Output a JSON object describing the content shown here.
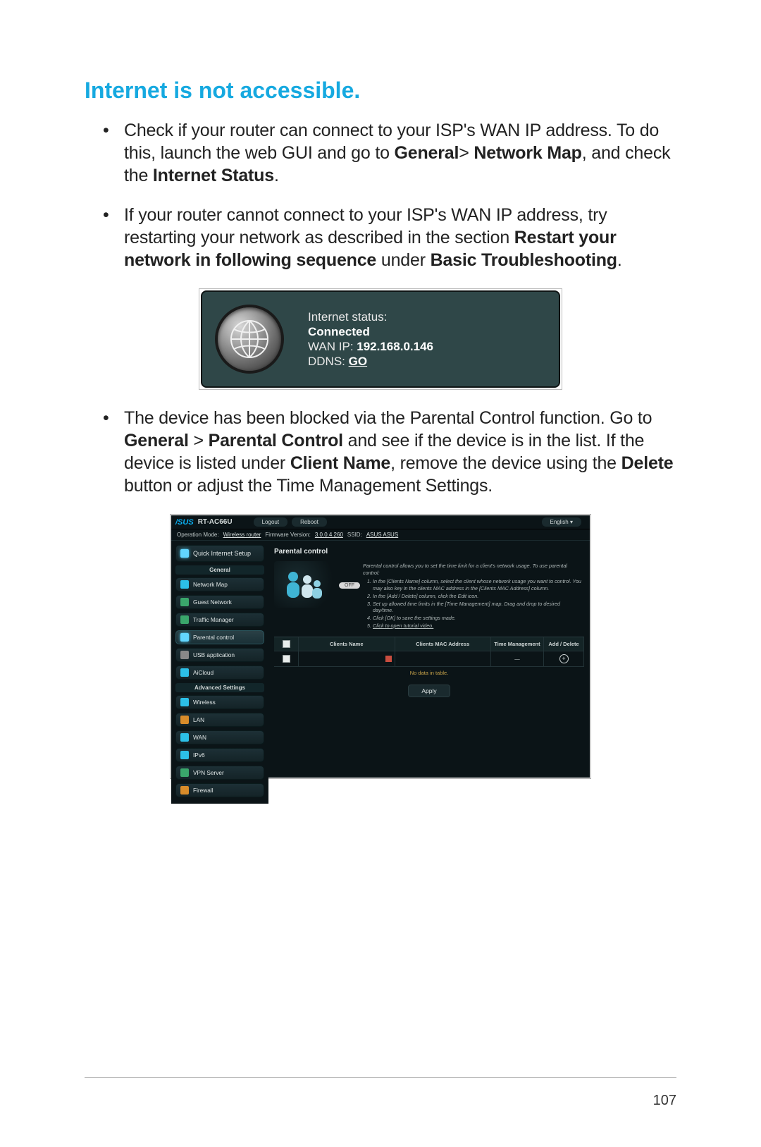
{
  "title": "Internet is not accessible.",
  "bullets": {
    "b1_pre": "Check if your router can connect to your ISP's WAN IP address. To do this, launch the web GUI and go to ",
    "b1_bold1": "General",
    "b1_mid1": "> ",
    "b1_bold2": "Network Map",
    "b1_mid2": ", and check the ",
    "b1_bold3": "Internet Status",
    "b1_end": ".",
    "b2_pre": "If your router cannot connect to your ISP's WAN IP address, try restarting your network as described in the section ",
    "b2_bold1": "Restart your network in following sequence",
    "b2_mid1": " under ",
    "b2_bold2": "Basic Troubleshooting",
    "b2_end": ".",
    "b3_pre": "The device has been blocked via the Parental Control function. Go to ",
    "b3_bold1": "General",
    "b3_mid1": " > ",
    "b3_bold2": "Parental Control",
    "b3_mid2": " and see if the device is in the list. If the device is listed under ",
    "b3_bold3": "Client Name",
    "b3_mid3": ", remove the device using the ",
    "b3_bold4": "Delete",
    "b3_end": " button or adjust the Time Management Settings."
  },
  "status_card": {
    "line1": "Internet status:",
    "line2": "Connected",
    "wan_label": "WAN IP: ",
    "wan_value": "192.168.0.146",
    "ddns_label": "DDNS: ",
    "ddns_value": "GO"
  },
  "gui": {
    "brand": "/SUS",
    "model": "RT-AC66U",
    "btn_logout": "Logout",
    "btn_reboot": "Reboot",
    "lang": "English",
    "op_mode_label": "Operation Mode:",
    "op_mode_value": "Wireless router",
    "fw_label": "Firmware Version:",
    "fw_value": "3.0.0.4.260",
    "ssid_label": "SSID:",
    "ssid_value": "ASUS  ASUS",
    "quick": "Quick Internet Setup",
    "hdr_general": "General",
    "nav": {
      "map": "Network Map",
      "guest": "Guest Network",
      "traffic": "Traffic Manager",
      "parental": "Parental control",
      "usb": "USB application",
      "aicloud": "AiCloud"
    },
    "hdr_adv": "Advanced Settings",
    "adv": {
      "wireless": "Wireless",
      "lan": "LAN",
      "wan": "WAN",
      "ipv6": "IPv6",
      "vpn": "VPN Server",
      "firewall": "Firewall"
    },
    "panel_title": "Parental control",
    "desc_intro": "Parental control allows you to set the time limit for a client's network usage. To use parental control:",
    "steps": {
      "s1": "In the [Clients Name] column, select the client whose network usage you want to control. You may also key in the clients MAC address in the [Clients MAC Address] column.",
      "s2": "In the [Add / Delete] column, click the Edit icon.",
      "s3": "Set up allowed time limits in the [Time Management] map. Drag and drop to desired day/time.",
      "s4": "Click [OK] to save the settings made.",
      "s5": "Click to open tutorial video."
    },
    "toggle": "OFF",
    "table": {
      "h_name": "Clients Name",
      "h_mac": "Clients MAC Address",
      "h_time": "Time Management",
      "h_act": "Add / Delete",
      "nodata": "No data in table.",
      "dash": "—"
    },
    "apply": "Apply"
  },
  "page_number": "107"
}
